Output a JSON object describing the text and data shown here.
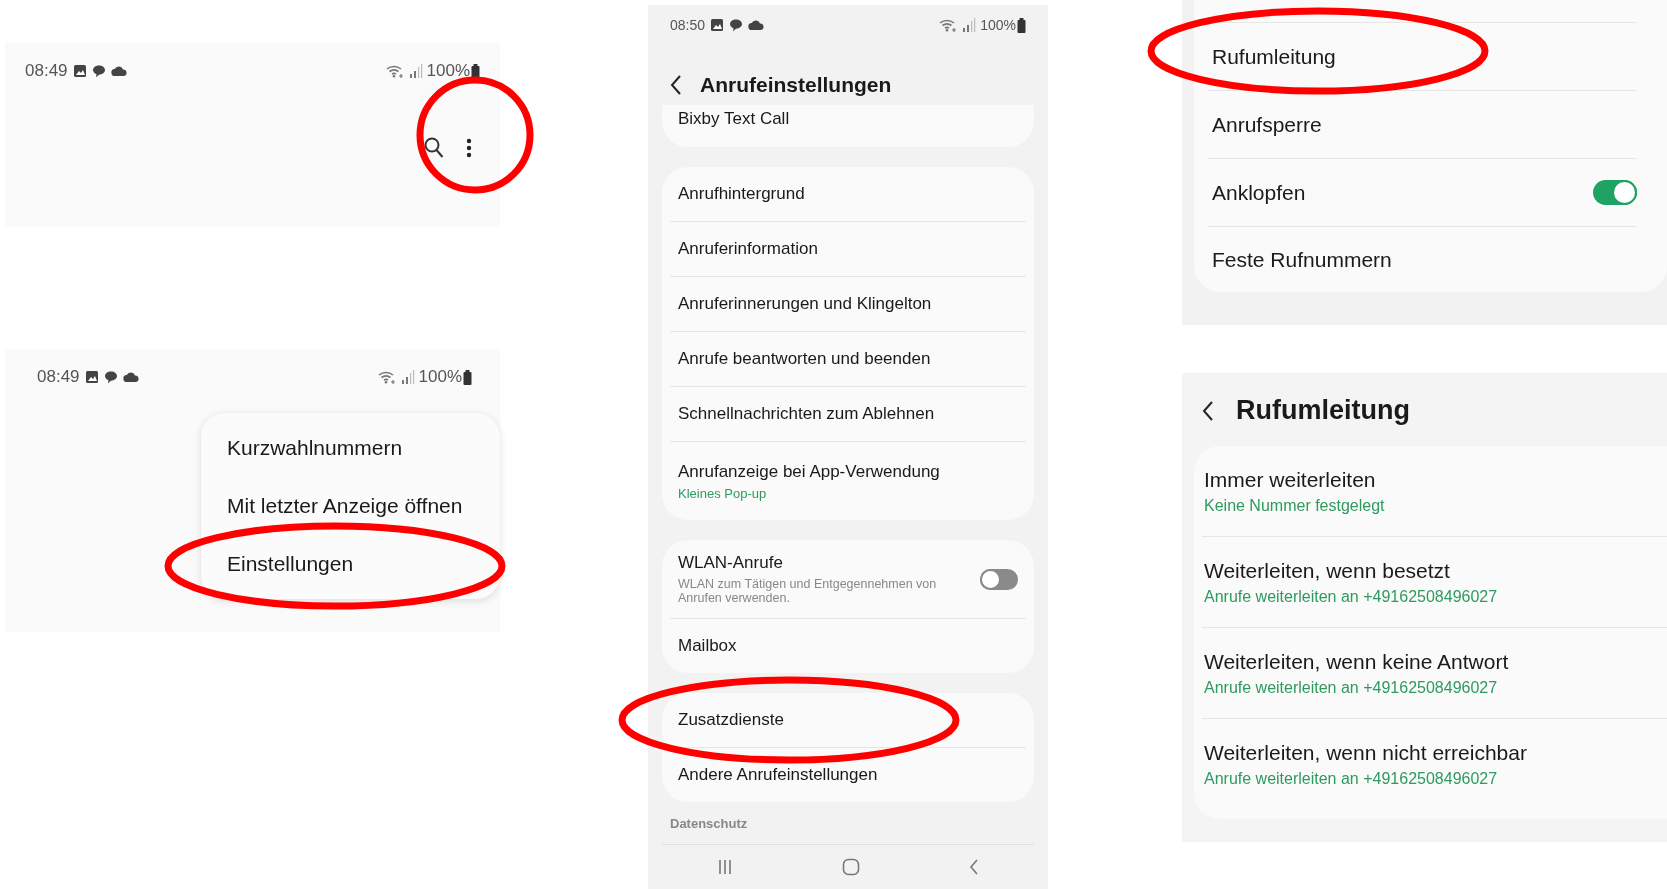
{
  "toolbar_screen": {
    "status_bar": {
      "time": "08:49",
      "battery": "100%"
    }
  },
  "menu_screen": {
    "status_bar": {
      "time": "08:49",
      "battery": "100%"
    },
    "menu_items": [
      {
        "label": "Kurzwahlnummern"
      },
      {
        "label": "Mit letzter Anzeige öffnen"
      },
      {
        "label": "Einstellungen"
      }
    ]
  },
  "call_settings": {
    "status_bar": {
      "time": "08:50",
      "battery": "100%"
    },
    "title": "Anrufeinstellungen",
    "groups": [
      {
        "items": [
          {
            "kind": "link",
            "label": "Bixby Text Call"
          }
        ]
      },
      {
        "items": [
          {
            "kind": "link",
            "label": "Anrufhintergrund"
          },
          {
            "kind": "link",
            "label": "Anruferinformation"
          },
          {
            "kind": "link",
            "label": "Anruferinnerungen und Klingelton"
          },
          {
            "kind": "link",
            "label": "Anrufe beantworten und beenden"
          },
          {
            "kind": "link",
            "label": "Schnellnachrichten zum Ablehnen"
          },
          {
            "kind": "link",
            "label": "Anrufanzeige bei App-Verwendung",
            "summary": "Kleines Pop-up"
          }
        ]
      },
      {
        "items": [
          {
            "kind": "switch",
            "label": "WLAN-Anrufe",
            "description": "WLAN zum Tätigen und Entgegennehmen von Anrufen verwenden.",
            "on": false
          },
          {
            "kind": "link",
            "label": "Mailbox"
          }
        ]
      },
      {
        "items": [
          {
            "kind": "link",
            "label": "Zusatzdienste"
          },
          {
            "kind": "link",
            "label": "Andere Anrufeinstellungen"
          }
        ]
      }
    ],
    "section_header": "Datenschutz"
  },
  "supplementary_services": {
    "items": [
      {
        "kind": "link",
        "label": "Rufumleitung"
      },
      {
        "kind": "link",
        "label": "Anrufsperre"
      },
      {
        "kind": "switch",
        "label": "Anklopfen",
        "on": true
      },
      {
        "kind": "link",
        "label": "Feste Rufnummern"
      }
    ]
  },
  "call_forwarding": {
    "title": "Rufumleitung",
    "items": [
      {
        "label": "Immer weiterleiten",
        "summary": "Keine Nummer festgelegt"
      },
      {
        "label": "Weiterleiten, wenn besetzt",
        "summary": "Anrufe weiterleiten an +49162508496027"
      },
      {
        "label": "Weiterleiten, wenn keine Antwort",
        "summary": "Anrufe weiterleiten an +49162508496027"
      },
      {
        "label": "Weiterleiten, wenn nicht erreichbar",
        "summary": "Anrufe weiterleiten an +49162508496027"
      }
    ]
  }
}
